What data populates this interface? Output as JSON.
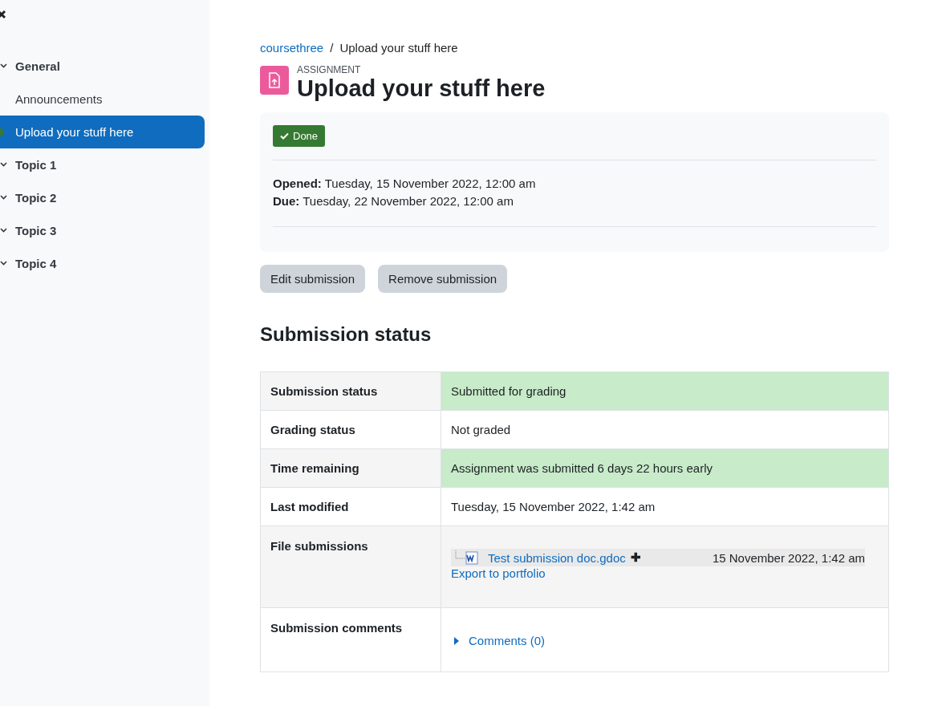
{
  "sidebar": {
    "items": [
      {
        "label": "General",
        "kind": "section",
        "expanded": true,
        "selected": false,
        "completed": false
      },
      {
        "label": "Announcements",
        "kind": "activity",
        "selected": false,
        "completed": false
      },
      {
        "label": "Upload your stuff here",
        "kind": "activity",
        "selected": true,
        "completed": true
      },
      {
        "label": "Topic 1",
        "kind": "section",
        "expanded": true,
        "selected": false,
        "completed": false
      },
      {
        "label": "Topic 2",
        "kind": "section",
        "expanded": true,
        "selected": false,
        "completed": false
      },
      {
        "label": "Topic 3",
        "kind": "section",
        "expanded": true,
        "selected": false,
        "completed": false
      },
      {
        "label": "Topic 4",
        "kind": "section",
        "expanded": true,
        "selected": false,
        "completed": false
      }
    ]
  },
  "breadcrumb": [
    {
      "label": "coursethree",
      "link": true
    },
    {
      "label": "Upload your stuff here",
      "link": false
    }
  ],
  "breadcrumb_separator": "/",
  "header": {
    "type_label": "ASSIGNMENT",
    "title": "Upload your stuff here"
  },
  "activity_info": {
    "completion": {
      "label": "Done",
      "done": true
    },
    "dates": [
      {
        "label": "Opened:",
        "value": "Tuesday, 15 November 2022, 12:00 am"
      },
      {
        "label": "Due:",
        "value": "Tuesday, 22 November 2022, 12:00 am"
      }
    ]
  },
  "buttons": [
    "Edit submission",
    "Remove submission"
  ],
  "submission_heading": "Submission status",
  "table": {
    "rows": [
      {
        "kind": "text",
        "label": "Submission status",
        "value": "Submitted for grading",
        "highlight": true
      },
      {
        "kind": "text",
        "label": "Grading status",
        "value": "Not graded",
        "highlight": false
      },
      {
        "kind": "text",
        "label": "Time remaining",
        "value": "Assignment was submitted 6 days 22 hours early",
        "highlight": true
      },
      {
        "kind": "text",
        "label": "Last modified",
        "value": "Tuesday, 15 November 2022, 1:42 am",
        "highlight": false
      },
      {
        "kind": "files",
        "label": "File submissions",
        "highlight": false,
        "file": {
          "name": "Test submission doc.gdoc",
          "action": "✚",
          "date": "15 November 2022, 1:42 am"
        },
        "link": "Export to portfolio"
      },
      {
        "kind": "comments",
        "label": "Submission comments",
        "highlight": false,
        "expanded": false,
        "link": "Comments (0)"
      }
    ]
  }
}
